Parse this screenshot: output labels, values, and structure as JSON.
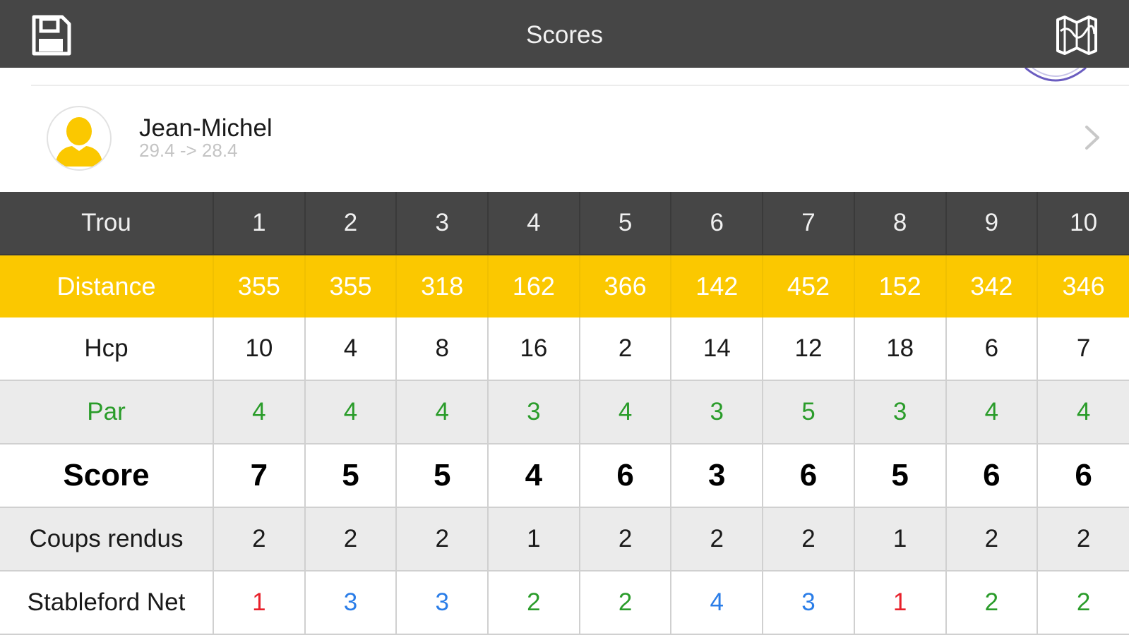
{
  "navbar": {
    "title": "Scores",
    "save_icon": "floppy-disk-icon",
    "course_icon": "course-logo-icon"
  },
  "player": {
    "name": "Jean-Michel",
    "handicap_change": "29.4 -> 28.4",
    "avatar_icon": "user-avatar-icon",
    "chevron_icon": "chevron-right-icon"
  },
  "colors": {
    "navbar_bg": "#464646",
    "distance_bg": "#fbc800",
    "par_text": "#2a9c2a",
    "pts_red": "#e8202a",
    "pts_blue": "#2a7de8",
    "pts_green": "#2a9c2a",
    "stripe_bg": "#ebebeb"
  },
  "scorecard": {
    "labels": {
      "hole": "Trou",
      "distance": "Distance",
      "hcp": "Hcp",
      "par": "Par",
      "score": "Score",
      "strokes_received": "Coups rendus",
      "stableford": "Stableford Net"
    },
    "holes": [
      "1",
      "2",
      "3",
      "4",
      "5",
      "6",
      "7",
      "8",
      "9",
      "10"
    ],
    "distance": [
      "355",
      "355",
      "318",
      "162",
      "366",
      "142",
      "452",
      "152",
      "342",
      "346"
    ],
    "hcp": [
      "10",
      "4",
      "8",
      "16",
      "2",
      "14",
      "12",
      "18",
      "6",
      "7"
    ],
    "par": [
      "4",
      "4",
      "4",
      "3",
      "4",
      "3",
      "5",
      "3",
      "4",
      "4"
    ],
    "score": [
      "7",
      "5",
      "5",
      "4",
      "6",
      "3",
      "6",
      "5",
      "6",
      "6"
    ],
    "strokes_received": [
      "2",
      "2",
      "2",
      "1",
      "2",
      "2",
      "2",
      "1",
      "2",
      "2"
    ],
    "stableford": [
      "1",
      "3",
      "3",
      "2",
      "2",
      "4",
      "3",
      "1",
      "2",
      "2"
    ],
    "stableford_colors": [
      "red",
      "blue",
      "blue",
      "green",
      "green",
      "blue",
      "blue",
      "red",
      "green",
      "green"
    ]
  }
}
